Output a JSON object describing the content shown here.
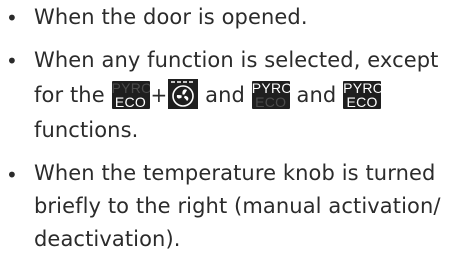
{
  "bullet_glyph": "•",
  "items": [
    {
      "text": "When the door is opened."
    },
    {
      "line1": "When any function is selected, except",
      "line2_prefix": "for the",
      "plus": "+",
      "and1": "and",
      "and2": "and",
      "line3": "functions."
    },
    {
      "line1": "When the temperature knob is turned",
      "line2": "briefly to the right (manual activation/",
      "line3": "deactivation)."
    }
  ],
  "badges": {
    "pyro_eco_dim_pyro": {
      "top": "PYRO",
      "bottom": "ECO"
    },
    "pyro_only": {
      "top": "PYRO",
      "bottom": "ECO"
    },
    "pyro_eco_full": {
      "top": "PYRO",
      "bottom": "ECO"
    }
  },
  "icons": {
    "fan": "fan-with-heating-element-icon"
  },
  "colors": {
    "text": "#2b2b2b",
    "badge_bg": "#1f1f1f",
    "badge_lit": "#ffffff",
    "badge_dim": "#4c4c4c"
  }
}
